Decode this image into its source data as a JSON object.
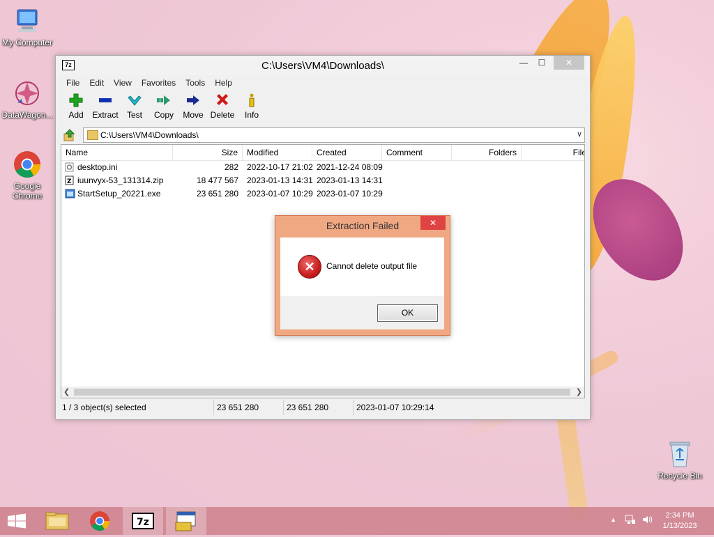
{
  "desktop": {
    "icons": [
      {
        "label": "My Computer",
        "icon": "computer-icon"
      },
      {
        "label": "DataWagon...",
        "icon": "datawagon-icon"
      },
      {
        "label": "Google Chrome",
        "icon": "chrome-icon"
      },
      {
        "label": "Recycle Bin",
        "icon": "recycle-bin-icon"
      }
    ]
  },
  "window": {
    "app_icon": "7z",
    "title": "C:\\Users\\VM4\\Downloads\\",
    "controls": {
      "minimize": "—",
      "maximize": "☐",
      "close": "✕"
    },
    "menu": [
      "File",
      "Edit",
      "View",
      "Favorites",
      "Tools",
      "Help"
    ],
    "toolbar": [
      {
        "label": "Add",
        "icon": "plus-icon",
        "color": "#1fa51f"
      },
      {
        "label": "Extract",
        "icon": "minus-icon",
        "color": "#1030b0"
      },
      {
        "label": "Test",
        "icon": "check-icon",
        "color": "#20b8c8"
      },
      {
        "label": "Copy",
        "icon": "copy-arrow-icon",
        "color": "#2a9a6a"
      },
      {
        "label": "Move",
        "icon": "move-arrow-icon",
        "color": "#1a2a90"
      },
      {
        "label": "Delete",
        "icon": "delete-x-icon",
        "color": "#d01818"
      },
      {
        "label": "Info",
        "icon": "info-icon",
        "color": "#c8a000"
      }
    ],
    "address": "C:\\Users\\VM4\\Downloads\\",
    "columns": [
      "Name",
      "Size",
      "Modified",
      "Created",
      "Comment",
      "Folders",
      "File"
    ],
    "files": [
      {
        "name": "desktop.ini",
        "size": "282",
        "modified": "2022-10-17 21:02",
        "created": "2021-12-24 08:09",
        "icon": "ini-file-icon"
      },
      {
        "name": "iuunvyx-53_131314.zip",
        "size": "18 477 567",
        "modified": "2023-01-13 14:31",
        "created": "2023-01-13 14:31",
        "icon": "zip-file-icon"
      },
      {
        "name": "StartSetup_20221.exe",
        "size": "23 651 280",
        "modified": "2023-01-07 10:29",
        "created": "2023-01-07 10:29",
        "icon": "exe-file-icon"
      }
    ],
    "status": {
      "selection": "1 / 3 object(s) selected",
      "size": "23 651 280",
      "packed": "23 651 280",
      "date": "2023-01-07 10:29:14"
    }
  },
  "dialog": {
    "title": "Extraction Failed",
    "close": "✕",
    "message": "Cannot delete output file",
    "ok_label": "OK"
  },
  "taskbar": {
    "clock_time": "2:34 PM",
    "clock_date": "1/13/2023"
  }
}
